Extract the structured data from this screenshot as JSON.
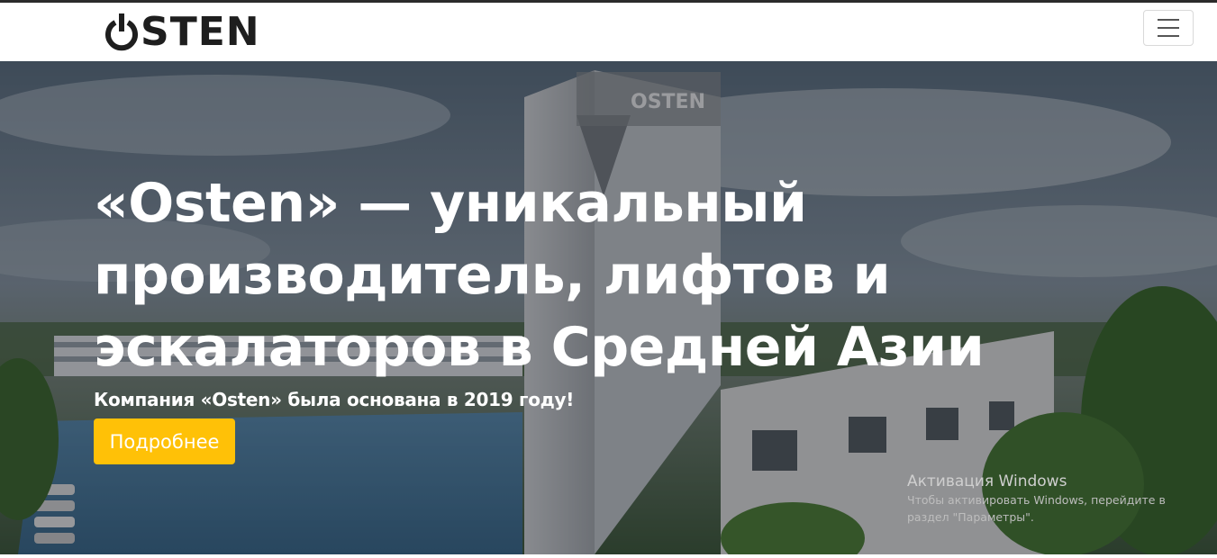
{
  "navbar": {
    "logo_text": "STEN",
    "menu_icon": "hamburger-menu-icon"
  },
  "hero": {
    "title_lines": [
      "«Osten» — уникальный",
      "производитель, лифтов и",
      "эскалаторов в Средней Азии"
    ],
    "subtitle": "Компания «Osten» была основана в 2019 году!",
    "button_label": "Подробнее",
    "building_sign": "OSTEN"
  },
  "windows_activation": {
    "title": "Активация Windows",
    "text": "Чтобы активировать Windows, перейдите в раздел \"Параметры\"."
  },
  "colors": {
    "accent": "#ffc107",
    "text_dark": "#1e1e1e",
    "white": "#ffffff"
  }
}
